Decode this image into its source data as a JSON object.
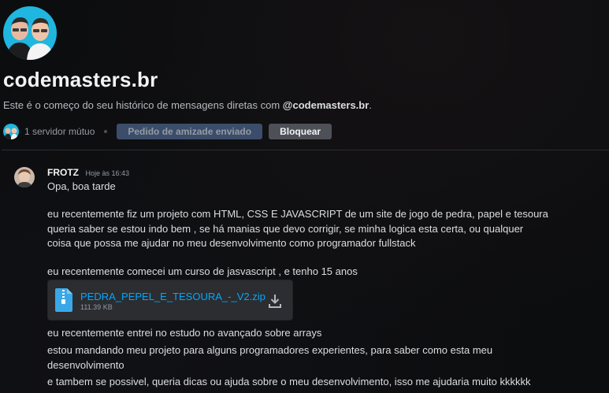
{
  "header": {
    "title": "codemasters.br",
    "intro_text": "Este é o começo do seu histórico de mensagens diretas com ",
    "intro_handle": "@codemasters.br",
    "intro_end": ".",
    "mutual_servers": "1 servidor mútuo",
    "friend_request_label": "Pedido de amizade enviado",
    "block_label": "Bloquear"
  },
  "message": {
    "author": "FROTZ",
    "timestamp": "Hoje às 16:43",
    "lines": [
      "Opa, boa tarde",
      "eu recentemente fiz um projeto com HTML, CSS E JAVASCRIPT de um site de jogo de pedra, papel e tesoura",
      "queria saber se estou indo bem , se há manias que devo corrigir, se minha logica esta certa, ou qualquer",
      "coisa que possa me ajudar no meu desenvolvimento como programador fullstack",
      "eu recentemente comecei um curso de jasvascript , e tenho 15 anos",
      "eu recentemente entrei no estudo no avançado sobre arrays",
      "estou mandando meu projeto para alguns programadores experientes, para saber como esta meu",
      "desenvolvimento",
      "e tambem se possivel, queria dicas ou ajuda sobre o meu desenvolvimento, isso me ajudaria muito kkkkkk"
    ],
    "attachment": {
      "filename": "PEDRA_PEPEL_E_TESOURA_-_V2.zip",
      "size": "111.39 KB",
      "icon": "zip-file-icon"
    }
  },
  "colors": {
    "background": "#0c0d0f",
    "link": "#00a8fc",
    "friend_button": "#3b4d6a",
    "block_button": "#4e5058"
  }
}
